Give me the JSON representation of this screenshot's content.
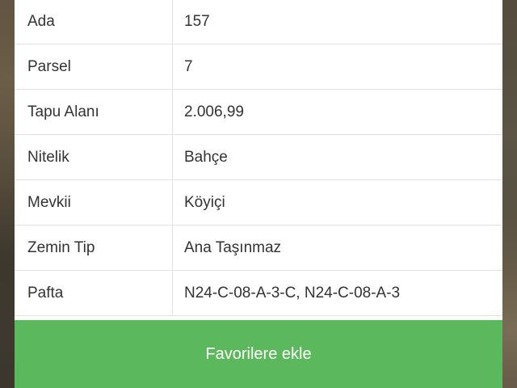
{
  "parcel_info": {
    "rows": [
      {
        "label": "Ada",
        "value": "157"
      },
      {
        "label": "Parsel",
        "value": "7"
      },
      {
        "label": "Tapu Alanı",
        "value": "2.006,99"
      },
      {
        "label": "Nitelik",
        "value": "Bahçe"
      },
      {
        "label": "Mevkii",
        "value": "Köyiçi"
      },
      {
        "label": "Zemin Tip",
        "value": "Ana Taşınmaz"
      },
      {
        "label": "Pafta",
        "value": "N24-C-08-A-3-C, N24-C-08-A-3"
      }
    ]
  },
  "actions": {
    "favorite_label": "Favorilere ekle"
  },
  "colors": {
    "button_green": "#5cb85c",
    "text": "#333333",
    "divider": "#e3e3e3"
  }
}
